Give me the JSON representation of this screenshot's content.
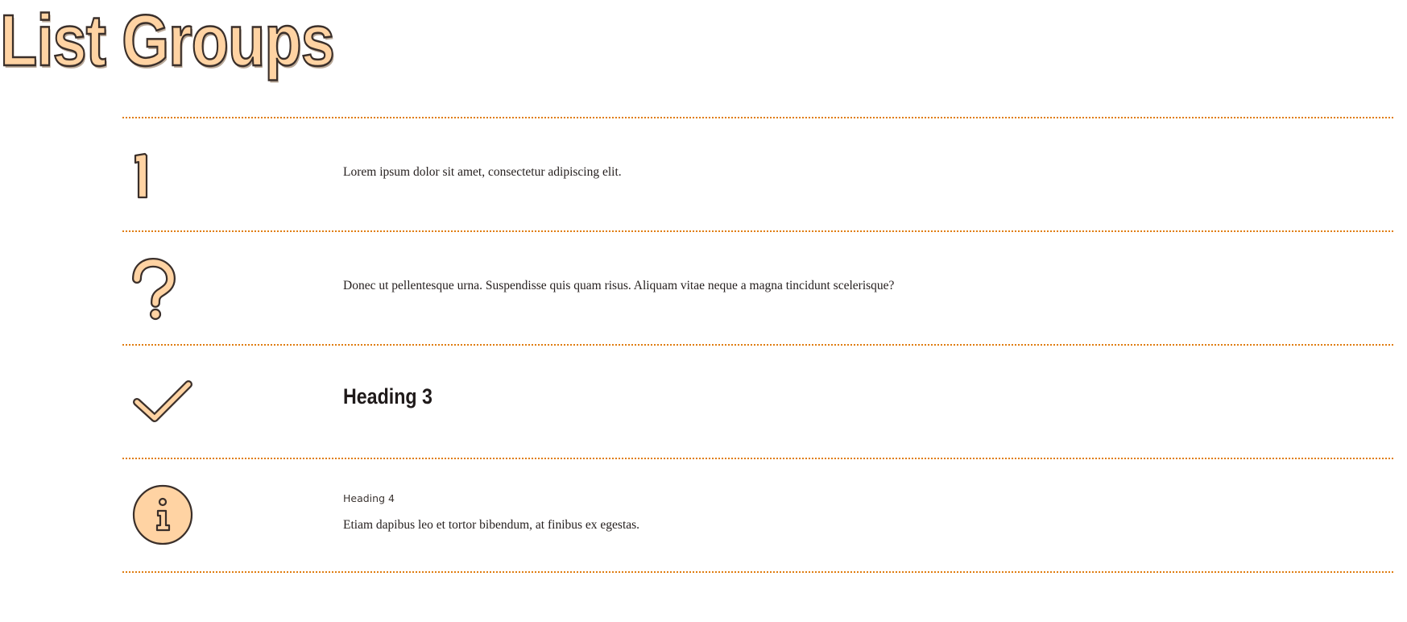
{
  "page": {
    "title": "List Groups"
  },
  "colors": {
    "icon_fill": "#ffd3a3",
    "icon_stroke": "#3a2f2a",
    "divider": "#e07d10",
    "text": "#26201f"
  },
  "list_group": {
    "items": [
      {
        "icon": "number-one-icon",
        "text": "Lorem ipsum dolor sit amet, consectetur adipiscing elit."
      },
      {
        "icon": "question-mark-icon",
        "text": "Donec ut pellentesque urna. Suspendisse quis quam risus. Aliquam vitae neque a magna tincidunt scelerisque?"
      },
      {
        "icon": "checkmark-icon",
        "heading": "Heading 3"
      },
      {
        "icon": "info-icon",
        "heading": "Heading 4",
        "text": "Etiam dapibus leo et tortor bibendum, at finibus ex egestas."
      }
    ]
  }
}
